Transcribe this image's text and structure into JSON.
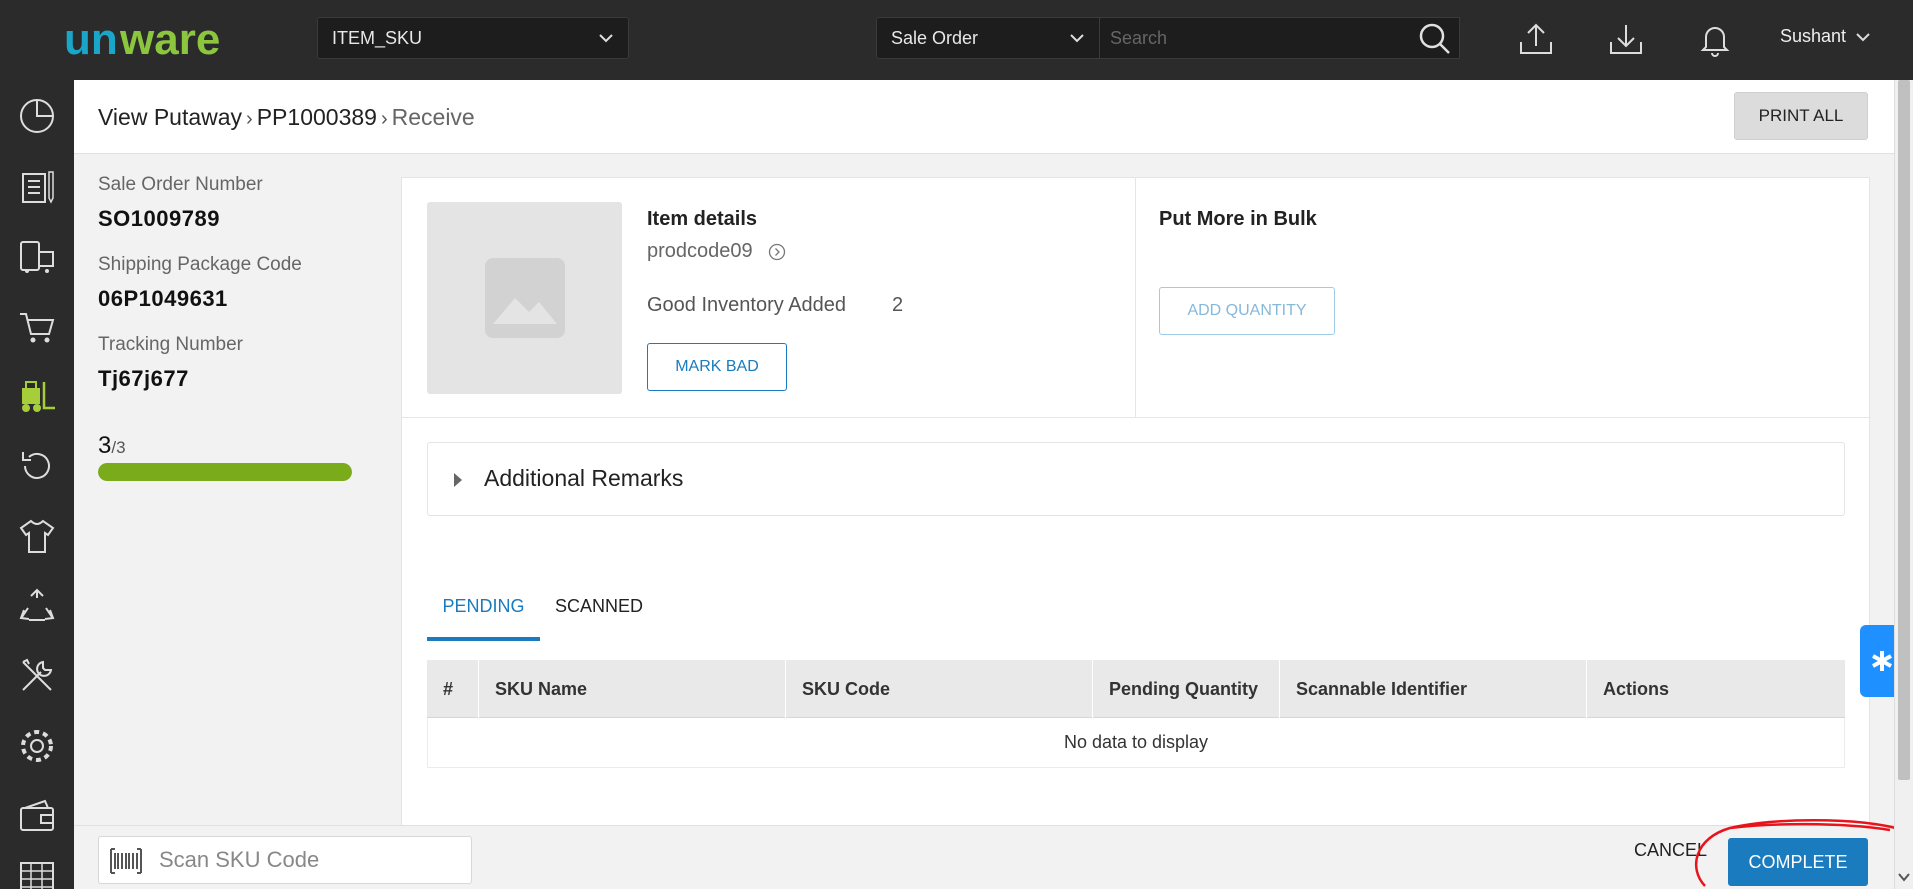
{
  "app": {
    "logo_text": "uniware"
  },
  "topbar": {
    "item_selector": "ITEM_SKU",
    "search_type": "Sale Order",
    "search_placeholder": "Search",
    "user_name": "Sushant"
  },
  "breadcrumb": [
    "View Putaway",
    "PP1000389",
    "Receive"
  ],
  "header": {
    "print_all_label": "PRINT ALL"
  },
  "info": {
    "sale_order_label": "Sale Order Number",
    "sale_order_value": "SO1009789",
    "shipping_label": "Shipping Package Code",
    "shipping_value": "06P1049631",
    "tracking_label": "Tracking Number",
    "tracking_value": "Tj67j677",
    "progress_done": "3",
    "progress_total": "/3",
    "progress_fraction": 1.0
  },
  "item": {
    "title": "Item details",
    "code": "prodcode09",
    "good_inventory_label": "Good Inventory Added",
    "good_inventory_value": "2",
    "mark_bad_label": "MARK BAD"
  },
  "bulk": {
    "title": "Put More in Bulk",
    "add_quantity_label": "ADD QUANTITY"
  },
  "remarks": {
    "label": "Additional Remarks"
  },
  "tabs": [
    {
      "label": "PENDING",
      "active": true
    },
    {
      "label": "SCANNED",
      "active": false
    }
  ],
  "table": {
    "columns": [
      "#",
      "SKU Name",
      "SKU Code",
      "Pending Quantity",
      "Scannable Identifier",
      "Actions"
    ],
    "empty_text": "No data to display"
  },
  "bottom": {
    "scan_placeholder": "Scan SKU Code",
    "cancel_label": "CANCEL",
    "complete_label": "COMPLETE"
  },
  "colors": {
    "primary": "#1a7bbf",
    "progress": "#7aab1b",
    "logo_blue": "#1aa6c8",
    "logo_green": "#8cc63f",
    "nav_active": "#a6ce39"
  },
  "icons": {
    "nav": [
      "dashboard-icon",
      "orders-icon",
      "shipping-icon",
      "cart-icon",
      "forklift-icon",
      "returns-icon",
      "shirt-icon",
      "recycle-icon",
      "tools-icon",
      "settings-icon",
      "wallet-icon",
      "table-icon"
    ]
  }
}
